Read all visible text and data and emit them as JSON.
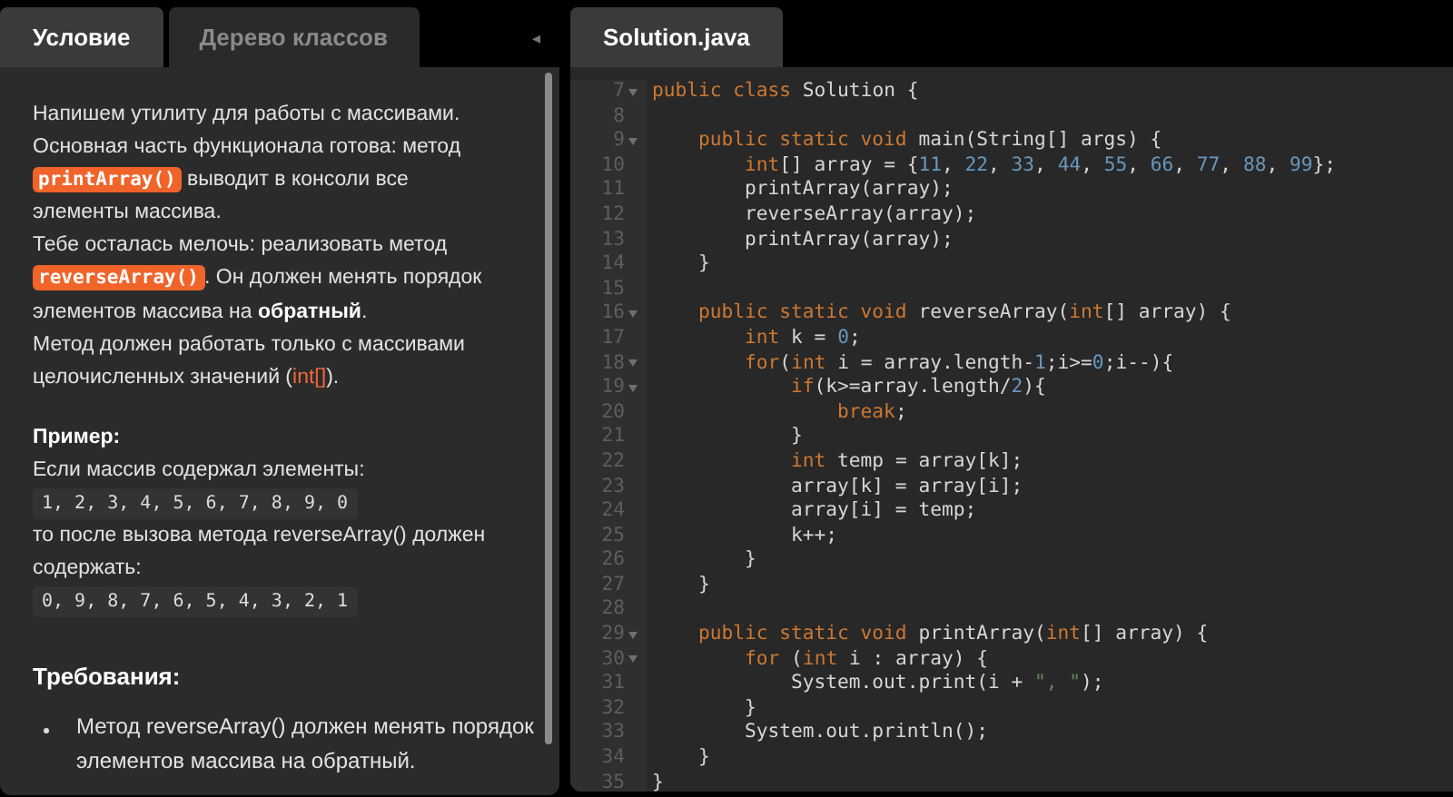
{
  "left_panel": {
    "tabs": [
      {
        "label": "Условие",
        "selected": true
      },
      {
        "label": "Дерево классов",
        "selected": false
      }
    ],
    "collapse_button": "◂",
    "paragraphs": [
      [
        {
          "kind": "text",
          "text": "Напишем утилиту для работы с массивами. Основная часть функционала готова: метод "
        },
        {
          "kind": "code",
          "text": "printArray()"
        },
        {
          "kind": "text",
          "text": " выводит в консоли все элементы массива."
        }
      ],
      [
        {
          "kind": "text",
          "text": "Тебе осталась мелочь: реализовать метод "
        },
        {
          "kind": "code",
          "text": "reverseArray()"
        },
        {
          "kind": "text",
          "text": ". Он должен менять порядок элементов массива на "
        },
        {
          "kind": "bold",
          "text": "обратный"
        },
        {
          "kind": "text",
          "text": "."
        }
      ],
      [
        {
          "kind": "text",
          "text": "Метод должен работать только с массивами целочисленных значений ("
        },
        {
          "kind": "accent",
          "text": "int[]"
        },
        {
          "kind": "text",
          "text": ")."
        }
      ]
    ],
    "example": {
      "heading": "Пример:",
      "before_text": "Если массив содержал элементы:",
      "before_code": "1, 2, 3, 4, 5, 6, 7, 8, 9, 0",
      "after_text": "то после вызова метода reverseArray() должен содержать:",
      "after_code": "0, 9, 8, 7, 6, 5, 4, 3, 2, 1"
    },
    "requirements": {
      "heading": "Требования:",
      "items": [
        "Метод reverseArray() должен менять порядок элементов массива на обратный."
      ]
    }
  },
  "editor": {
    "tabs": [
      {
        "label": "Solution.java",
        "selected": true
      }
    ],
    "lines": [
      {
        "number": "7",
        "foldable": true,
        "tokens": [
          {
            "kind": "kw",
            "text": "public class"
          },
          {
            "kind": "plain",
            "text": " Solution {"
          }
        ]
      },
      {
        "number": "8",
        "foldable": false
      },
      {
        "number": "9",
        "foldable": true,
        "tokens": [
          {
            "kind": "kw",
            "text": "    public static void"
          },
          {
            "kind": "plain",
            "text": " main(String[] args) {"
          }
        ]
      },
      {
        "number": "10",
        "foldable": false,
        "tokens": [
          {
            "kind": "kw",
            "text": "        int"
          },
          {
            "kind": "plain",
            "text": "[] array = {"
          },
          {
            "kind": "num",
            "text": "11"
          },
          {
            "kind": "plain",
            "text": ", "
          },
          {
            "kind": "num",
            "text": "22"
          },
          {
            "kind": "plain",
            "text": ", "
          },
          {
            "kind": "num",
            "text": "33"
          },
          {
            "kind": "plain",
            "text": ", "
          },
          {
            "kind": "num",
            "text": "44"
          },
          {
            "kind": "plain",
            "text": ", "
          },
          {
            "kind": "num",
            "text": "55"
          },
          {
            "kind": "plain",
            "text": ", "
          },
          {
            "kind": "num",
            "text": "66"
          },
          {
            "kind": "plain",
            "text": ", "
          },
          {
            "kind": "num",
            "text": "77"
          },
          {
            "kind": "plain",
            "text": ", "
          },
          {
            "kind": "num",
            "text": "88"
          },
          {
            "kind": "plain",
            "text": ", "
          },
          {
            "kind": "num",
            "text": "99"
          },
          {
            "kind": "plain",
            "text": "};"
          }
        ]
      },
      {
        "number": "11",
        "foldable": false,
        "tokens": [
          {
            "kind": "plain",
            "text": "        printArray(array);"
          }
        ]
      },
      {
        "number": "12",
        "foldable": false,
        "tokens": [
          {
            "kind": "plain",
            "text": "        reverseArray(array);"
          }
        ]
      },
      {
        "number": "13",
        "foldable": false,
        "tokens": [
          {
            "kind": "plain",
            "text": "        printArray(array);"
          }
        ]
      },
      {
        "number": "14",
        "foldable": false,
        "tokens": [
          {
            "kind": "plain",
            "text": "    }"
          }
        ]
      },
      {
        "number": "15",
        "foldable": false
      },
      {
        "number": "16",
        "foldable": true,
        "tokens": [
          {
            "kind": "kw",
            "text": "    public static void"
          },
          {
            "kind": "plain",
            "text": " reverseArray("
          },
          {
            "kind": "kw",
            "text": "int"
          },
          {
            "kind": "plain",
            "text": "[] array) {"
          }
        ]
      },
      {
        "number": "17",
        "foldable": false,
        "tokens": [
          {
            "kind": "kw",
            "text": "        int"
          },
          {
            "kind": "plain",
            "text": " k = "
          },
          {
            "kind": "num",
            "text": "0"
          },
          {
            "kind": "plain",
            "text": ";"
          }
        ]
      },
      {
        "number": "18",
        "foldable": true,
        "tokens": [
          {
            "kind": "kw",
            "text": "        for"
          },
          {
            "kind": "plain",
            "text": "("
          },
          {
            "kind": "kw",
            "text": "int"
          },
          {
            "kind": "plain",
            "text": " i = array.length-"
          },
          {
            "kind": "num",
            "text": "1"
          },
          {
            "kind": "plain",
            "text": ";i>="
          },
          {
            "kind": "num",
            "text": "0"
          },
          {
            "kind": "plain",
            "text": ";i--){"
          }
        ]
      },
      {
        "number": "19",
        "foldable": true,
        "tokens": [
          {
            "kind": "kw",
            "text": "            if"
          },
          {
            "kind": "plain",
            "text": "(k>=array.length/"
          },
          {
            "kind": "num",
            "text": "2"
          },
          {
            "kind": "plain",
            "text": "){"
          }
        ]
      },
      {
        "number": "20",
        "foldable": false,
        "tokens": [
          {
            "kind": "kw",
            "text": "                break"
          },
          {
            "kind": "plain",
            "text": ";"
          }
        ]
      },
      {
        "number": "21",
        "foldable": false,
        "tokens": [
          {
            "kind": "plain",
            "text": "            }"
          }
        ]
      },
      {
        "number": "22",
        "foldable": false,
        "tokens": [
          {
            "kind": "kw",
            "text": "            int"
          },
          {
            "kind": "plain",
            "text": " temp = array[k];"
          }
        ]
      },
      {
        "number": "23",
        "foldable": false,
        "tokens": [
          {
            "kind": "plain",
            "text": "            array[k] = array[i];"
          }
        ]
      },
      {
        "number": "24",
        "foldable": false,
        "tokens": [
          {
            "kind": "plain",
            "text": "            array[i] = temp;"
          }
        ]
      },
      {
        "number": "25",
        "foldable": false,
        "tokens": [
          {
            "kind": "plain",
            "text": "            k++;"
          }
        ]
      },
      {
        "number": "26",
        "foldable": false,
        "tokens": [
          {
            "kind": "plain",
            "text": "        }"
          }
        ]
      },
      {
        "number": "27",
        "foldable": false,
        "tokens": [
          {
            "kind": "plain",
            "text": "    }"
          }
        ]
      },
      {
        "number": "28",
        "foldable": false
      },
      {
        "number": "29",
        "foldable": true,
        "tokens": [
          {
            "kind": "kw",
            "text": "    public static void"
          },
          {
            "kind": "plain",
            "text": " printArray("
          },
          {
            "kind": "kw",
            "text": "int"
          },
          {
            "kind": "plain",
            "text": "[] array) {"
          }
        ]
      },
      {
        "number": "30",
        "foldable": true,
        "tokens": [
          {
            "kind": "kw",
            "text": "        for"
          },
          {
            "kind": "plain",
            "text": " ("
          },
          {
            "kind": "kw",
            "text": "int"
          },
          {
            "kind": "plain",
            "text": " i : array) {"
          }
        ]
      },
      {
        "number": "31",
        "foldable": false,
        "tokens": [
          {
            "kind": "plain",
            "text": "            System.out.print(i + "
          },
          {
            "kind": "str",
            "text": "\", \""
          },
          {
            "kind": "plain",
            "text": ");"
          }
        ]
      },
      {
        "number": "32",
        "foldable": false,
        "tokens": [
          {
            "kind": "plain",
            "text": "        }"
          }
        ]
      },
      {
        "number": "33",
        "foldable": false,
        "tokens": [
          {
            "kind": "plain",
            "text": "        System.out.println();"
          }
        ]
      },
      {
        "number": "34",
        "foldable": false,
        "tokens": [
          {
            "kind": "plain",
            "text": "    }"
          }
        ]
      },
      {
        "number": "35",
        "foldable": false,
        "tokens": [
          {
            "kind": "plain",
            "text": "}"
          }
        ]
      }
    ]
  }
}
